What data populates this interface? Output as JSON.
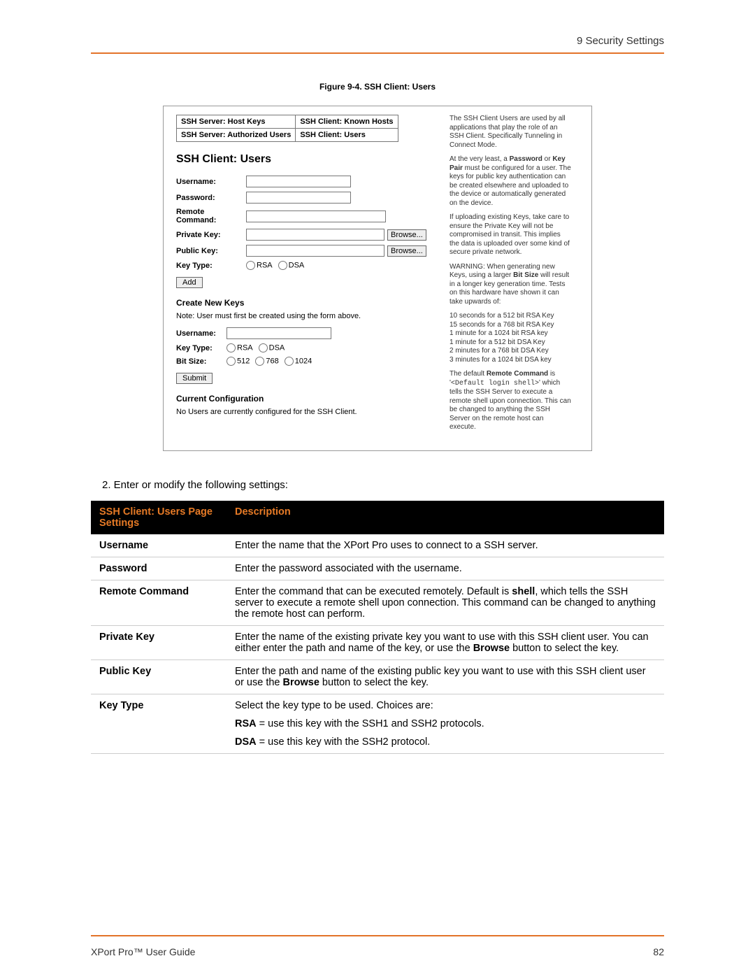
{
  "header": {
    "section": "9 Security Settings"
  },
  "figure": {
    "caption": "Figure 9-4. SSH Client: Users",
    "tabs": {
      "r1c1": "SSH Server: Host Keys",
      "r1c2": "SSH Client: Known Hosts",
      "r2c1": "SSH Server: Authorized Users",
      "r2c2": "SSH Client: Users"
    },
    "panel_title": "SSH Client: Users",
    "labels": {
      "username": "Username:",
      "password": "Password:",
      "remote_cmd_l1": "Remote",
      "remote_cmd_l2": "Command:",
      "private_key": "Private Key:",
      "public_key": "Public Key:",
      "key_type": "Key Type:",
      "bit_size": "Bit Size:"
    },
    "radios": {
      "rsa": "RSA",
      "dsa": "DSA",
      "b512": "512",
      "b768": "768",
      "b1024": "1024"
    },
    "buttons": {
      "browse": "Browse...",
      "add": "Add",
      "submit": "Submit"
    },
    "create_keys_heading": "Create New Keys",
    "create_keys_note": "Note: User must first be created using the form above.",
    "current_config_heading": "Current Configuration",
    "current_config_text": "No Users are currently configured for the SSH Client.",
    "right": {
      "p1a": "The SSH Client Users are used by all applications that play the role of an SSH Client. Specifically Tunneling in Connect Mode.",
      "p2a": "At the very least, a ",
      "p2b": "Password",
      "p2c": " or ",
      "p2d": "Key Pair",
      "p2e": " must be configured for a user. The keys for public key authentication can be created elsewhere and uploaded to the device or automatically generated on the device.",
      "p3": "If uploading existing Keys, take care to ensure the Private Key will not be compromised in transit. This implies the data is uploaded over some kind of secure private network.",
      "p4a": "WARNING: When generating new Keys, using a larger ",
      "p4b": "Bit Size",
      "p4c": " will result in a longer key generation time. Tests on this hardware have shown it can take upwards of:",
      "times": [
        "10 seconds for a 512 bit RSA Key",
        "15 seconds for a 768 bit RSA Key",
        "1 minute for a 1024 bit RSA key",
        "1 minute for a 512 bit DSA Key",
        "2 minutes for a 768 bit DSA Key",
        "3 minutes for a 1024 bit DSA key"
      ],
      "p5a": "The default ",
      "p5b": "Remote Command",
      "p5c": " is '",
      "p5d": "<Default login shell>",
      "p5e": "' which tells the SSH Server to execute a remote shell upon connection. This can be changed to anything the SSH Server on the remote host can execute."
    }
  },
  "step": "2.   Enter or modify the following settings:",
  "table": {
    "h1": "SSH Client: Users Page Settings",
    "h2": "Description",
    "rows": [
      {
        "label": "Username",
        "desc": "Enter the name that the XPort Pro uses to connect to a SSH server."
      },
      {
        "label": "Password",
        "desc": "Enter the password associated with the username."
      },
      {
        "label": "Remote Command",
        "desc_pre": "Enter the command that can be executed remotely. Default is ",
        "bold1": "shell",
        "desc_post": ", which tells the SSH server to execute a remote shell upon connection. This command can be changed to anything the remote host can perform."
      },
      {
        "label": "Private Key",
        "desc_pre": "Enter the name of the existing private key you want to use with this SSH client user. You can either enter the path and name of the key, or use the ",
        "bold1": "Browse",
        "desc_post": " button to select the key."
      },
      {
        "label": "Public Key",
        "desc_pre": "Enter the path and name of the existing public key you want to use with this SSH client user or use the ",
        "bold1": "Browse",
        "desc_post": " button to select the key."
      },
      {
        "label": "Key Type",
        "kt_intro": "Select the key type to be used. Choices are:",
        "kt_rsa_b": "RSA",
        "kt_rsa": " = use this key with the SSH1 and SSH2 protocols.",
        "kt_dsa_b": "DSA",
        "kt_dsa": " = use this key with the SSH2 protocol."
      }
    ]
  },
  "footer": {
    "left": "XPort Pro™ User Guide",
    "right": "82"
  }
}
